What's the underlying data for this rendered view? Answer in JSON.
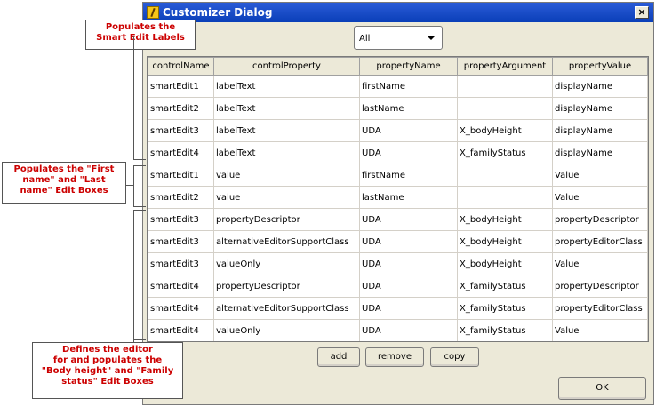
{
  "window": {
    "title": "Customizer Dialog",
    "close_glyph": "×"
  },
  "filter": {
    "selected": "All"
  },
  "table": {
    "columns": [
      "controlName",
      "controlProperty",
      "propertyName",
      "propertyArgument",
      "propertyValue"
    ],
    "rows": [
      [
        "smartEdit1",
        "labelText",
        "firstName",
        "",
        "displayName"
      ],
      [
        "smartEdit2",
        "labelText",
        "lastName",
        "",
        "displayName"
      ],
      [
        "smartEdit3",
        "labelText",
        "UDA",
        "X_bodyHeight",
        "displayName"
      ],
      [
        "smartEdit4",
        "labelText",
        "UDA",
        "X_familyStatus",
        "displayName"
      ],
      [
        "smartEdit1",
        "value",
        "firstName",
        "",
        "Value"
      ],
      [
        "smartEdit2",
        "value",
        "lastName",
        "",
        "Value"
      ],
      [
        "smartEdit3",
        "propertyDescriptor",
        "UDA",
        "X_bodyHeight",
        "propertyDescriptor"
      ],
      [
        "smartEdit3",
        "alternativeEditorSupportClass",
        "UDA",
        "X_bodyHeight",
        "propertyEditorClass"
      ],
      [
        "smartEdit3",
        "valueOnly",
        "UDA",
        "X_bodyHeight",
        "Value"
      ],
      [
        "smartEdit4",
        "propertyDescriptor",
        "UDA",
        "X_familyStatus",
        "propertyDescriptor"
      ],
      [
        "smartEdit4",
        "alternativeEditorSupportClass",
        "UDA",
        "X_familyStatus",
        "propertyEditorClass"
      ],
      [
        "smartEdit4",
        "valueOnly",
        "UDA",
        "X_familyStatus",
        "Value"
      ]
    ]
  },
  "buttons": {
    "add": "add",
    "remove": "remove",
    "copy": "copy",
    "ok": "OK"
  },
  "annotations": {
    "labels_1": "Populates the",
    "labels_2": "Smart Edit Labels",
    "edit_1": "Populates the \"First",
    "edit_2": "name\" and \"Last",
    "edit_3": "name\" Edit Boxes",
    "editor_1": "Defines the editor",
    "editor_2": "for and populates the",
    "editor_3": "\"Body height\" and \"Family",
    "editor_4": "status\" Edit Boxes"
  },
  "colors": {
    "title_bar": "#0a3fb8",
    "annotation_text": "#cc0000",
    "dialog_bg": "#ece9d8"
  }
}
